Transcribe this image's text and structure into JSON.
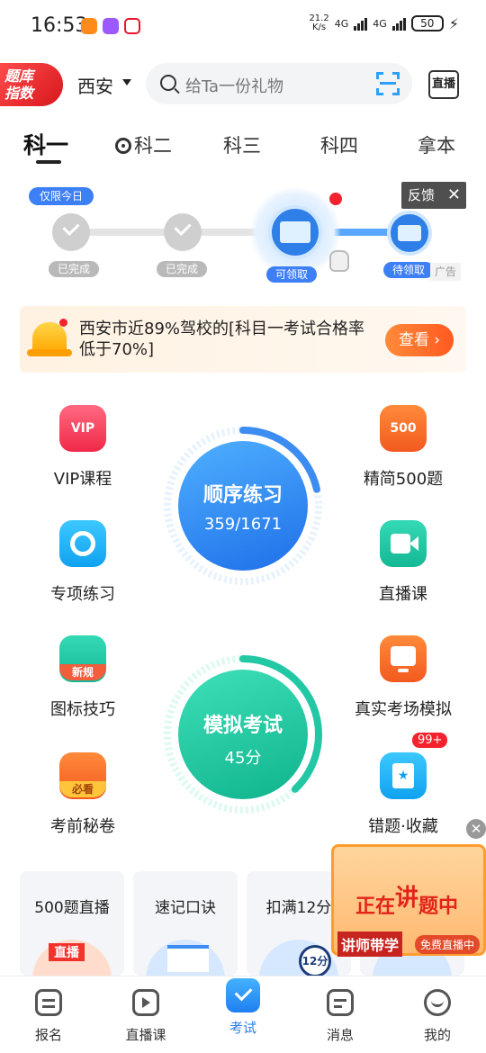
{
  "status_bar": {
    "time": "16:53",
    "net_speed_top": "21.2",
    "net_speed_bottom": "K/s",
    "network_1": "4G",
    "network_2": "4G",
    "battery": "50"
  },
  "header": {
    "logo_text_line1": "题库",
    "logo_text_line2": "指数",
    "city": "西安",
    "search_placeholder": "给Ta一份礼物",
    "live_label": "直播"
  },
  "tabs": [
    {
      "label": "科一"
    },
    {
      "label": "科二"
    },
    {
      "label": "科三"
    },
    {
      "label": "科四"
    },
    {
      "label": "拿本"
    }
  ],
  "progress": {
    "today_badge": "仅限今日",
    "steps": [
      {
        "status": "已完成"
      },
      {
        "status": "已完成"
      },
      {
        "status": "可领取"
      },
      {
        "status": "待领取"
      }
    ],
    "feedback": "反馈",
    "ad_label": "广告"
  },
  "notice": {
    "text": "西安市近89%驾校的[科目一考试合格率低于70%]",
    "button": "查看"
  },
  "features": {
    "vip": "VIP课程",
    "special": "专项练习",
    "sign_tips": "图标技巧",
    "sign_badge": "新规",
    "exam_secret": "考前秘卷",
    "exam_badge": "必看",
    "q500": "精简500题",
    "q500_icon": "500",
    "live_class": "直播课",
    "real_exam": "真实考场模拟",
    "wrong_fav": "错题·收藏",
    "wrong_badge": "99+",
    "vip_icon": "VIP"
  },
  "practice": {
    "title": "顺序练习",
    "progress_text": "359/1671",
    "done": 359,
    "total": 1671
  },
  "mock_exam": {
    "title": "模拟考试",
    "score": "45分"
  },
  "cards": [
    {
      "title": "500题直播"
    },
    {
      "title": "速记口诀"
    },
    {
      "title": "扣满12分"
    }
  ],
  "card_art": {
    "live_sign": "直播",
    "points_badge": "12分"
  },
  "promo": {
    "title_a": "正在",
    "title_b": "讲",
    "title_c": "题中",
    "left": "讲师带学",
    "right": "免费直播中"
  },
  "bottom_nav": [
    {
      "label": "报名"
    },
    {
      "label": "直播课"
    },
    {
      "label": "考试"
    },
    {
      "label": "消息"
    },
    {
      "label": "我的"
    }
  ],
  "colors": {
    "accent_blue": "#2f7fe8",
    "accent_orange": "#ff5a1f",
    "mint": "#22c8a3"
  }
}
